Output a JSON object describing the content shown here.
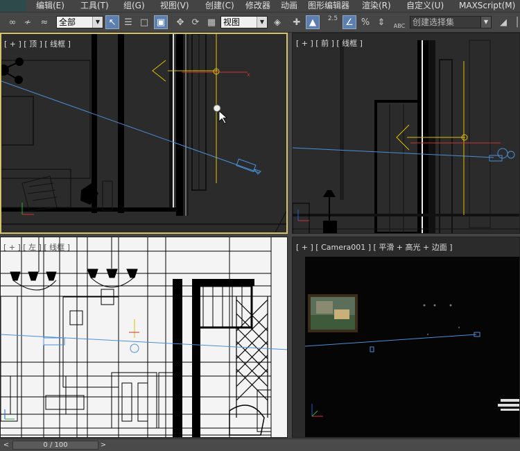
{
  "menubar": {
    "items": [
      "编辑(E)",
      "工具(T)",
      "组(G)",
      "视图(V)",
      "创建(C)",
      "修改器",
      "动画",
      "图形编辑器",
      "渲染(R)",
      "自定义(U)",
      "MAXScript(M)"
    ]
  },
  "toolbar": {
    "selection_filter": "全部",
    "reference_coord": "视图",
    "named_selection_placeholder": "创建选择集",
    "snap_angle_label": "2.5",
    "abc_label": "ABC"
  },
  "viewports": {
    "top": {
      "label": "[ + ] [ 顶 ] [ 线框 ]"
    },
    "front": {
      "label": "[ + ] [ 前 ] [ 线框 ]"
    },
    "left": {
      "label": "[ + ] [ 左 ] [ 线框 ]"
    },
    "camera": {
      "label": "[ + ] [ Camera001 ] [ 平滑 + 高光 + 边面 ]"
    }
  },
  "timeline": {
    "frame_display": "0 / 100",
    "prev_label": "<",
    "next_label": ">"
  },
  "colors": {
    "viewport_bg": "#2b2b2b",
    "camera_bg": "#050505",
    "active_border": "#d6c36a",
    "camera_line": "#4a90d9",
    "light_yellow": "#e0c000",
    "axis_red": "#d23030",
    "toolbar_active": "#5a7fb0"
  }
}
